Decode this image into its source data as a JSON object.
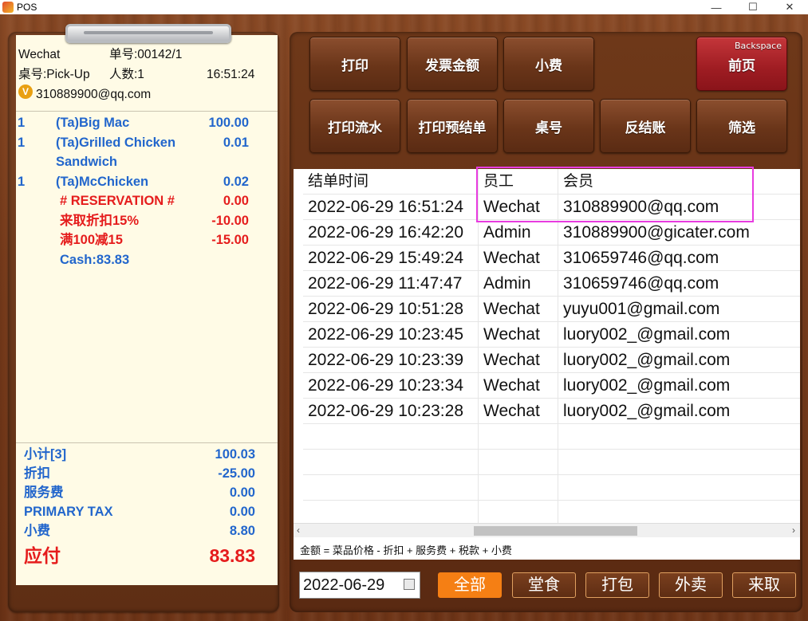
{
  "window": {
    "title": "POS",
    "minimize": "—",
    "maximize": "☐",
    "close": "✕"
  },
  "receipt": {
    "employee": "Wechat",
    "order_no": "单号:00142/1",
    "table": "桌号:Pick-Up",
    "guests": "人数:1",
    "time": "16:51:24",
    "member_badge": "V",
    "member": "310889900@qq.com",
    "items": [
      {
        "qty": "1",
        "name": "(Ta)Big Mac",
        "price": "100.00"
      },
      {
        "qty": "1",
        "name": "(Ta)Grilled Chicken",
        "price": "0.01"
      },
      {
        "qty": "",
        "name": "Sandwich",
        "price": ""
      },
      {
        "qty": "1",
        "name": "(Ta)McChicken",
        "price": "0.02"
      },
      {
        "qty": "",
        "name": "# RESERVATION #",
        "price": "0.00"
      },
      {
        "qty": "",
        "name": "来取折扣15%",
        "price": "-10.00"
      },
      {
        "qty": "",
        "name": "满100减15",
        "price": "-15.00"
      },
      {
        "qty": "",
        "name": "Cash:83.83",
        "price": ""
      }
    ],
    "totals": [
      {
        "label": "小计[3]",
        "value": "100.03"
      },
      {
        "label": "折扣",
        "value": "-25.00"
      },
      {
        "label": "服务费",
        "value": "0.00"
      },
      {
        "label": "PRIMARY TAX",
        "value": "0.00"
      },
      {
        "label": "小费",
        "value": "8.80"
      }
    ],
    "due_label": "应付",
    "due_value": "83.83"
  },
  "buttons": {
    "print": "打印",
    "invoice_amount": "发票金额",
    "tip": "小费",
    "prev_page": "前页",
    "prev_page_key": "Backspace",
    "print_journal": "打印流水",
    "print_pre_bill": "打印预结单",
    "table_no": "桌号",
    "reverse_checkout": "反结账",
    "filter": "筛选"
  },
  "table": {
    "headers": [
      "结单时间",
      "员工",
      "会员"
    ],
    "rows": [
      [
        "2022-06-29 16:51:24",
        "Wechat",
        "310889900@qq.com"
      ],
      [
        "2022-06-29 16:42:20",
        "Admin",
        "310889900@gicater.com"
      ],
      [
        "2022-06-29 15:49:24",
        "Wechat",
        "310659746@qq.com"
      ],
      [
        "2022-06-29 11:47:47",
        "Admin",
        "310659746@qq.com"
      ],
      [
        "2022-06-29 10:51:28",
        "Wechat",
        "yuyu001@gmail.com"
      ],
      [
        "2022-06-29 10:23:45",
        "Wechat",
        "luory002_@gmail.com"
      ],
      [
        "2022-06-29 10:23:39",
        "Wechat",
        "luory002_@gmail.com"
      ],
      [
        "2022-06-29 10:23:34",
        "Wechat",
        "luory002_@gmail.com"
      ],
      [
        "2022-06-29 10:23:28",
        "Wechat",
        "luory002_@gmail.com"
      ]
    ],
    "formula": "金额 = 菜品价格 - 折扣 + 服务费 + 税款 + 小费",
    "scroll_left": "‹",
    "scroll_right": "›"
  },
  "filters": {
    "date": "2022-06-29",
    "all": "全部",
    "dine_in": "堂食",
    "takeaway": "打包",
    "delivery": "外卖",
    "pickup": "来取"
  },
  "colors": {
    "highlight": "#e83ce0",
    "active_filter": "#f57f14",
    "item_blue": "#2266cc",
    "item_red": "#e51c1c"
  }
}
